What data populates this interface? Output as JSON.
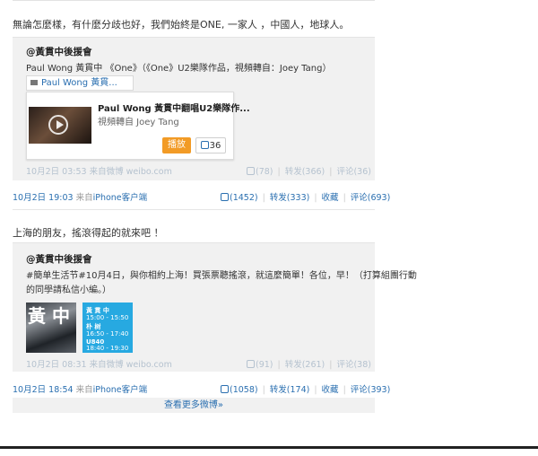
{
  "post1": {
    "text": "無論怎麼樣，有什麼分歧也好，我們始終是ONE, 一家人 ，中國人，地球人。",
    "repost": {
      "author": "@黃貫中後援會",
      "text": "Paul Wong 黃貫中 《One》（《One》U2樂隊作品，視頻轉自：Joey Tang）",
      "video_link": "Paul Wong 黃貫...",
      "card": {
        "title": "Paul Wong 黃貫中翻唱U2樂隊作...",
        "subtitle": "視頻轉自 Joey Tang",
        "play_label": "播放",
        "like_count": "36"
      },
      "meta": {
        "date": "10月2日 03:53",
        "source_prefix": "来自",
        "source": "微博 weibo.com"
      },
      "actions": {
        "like": "(78)",
        "forward": "转发(366)",
        "comment": "评论(36)"
      }
    },
    "meta": {
      "date": "10月2日 19:03",
      "source_prefix": "来自",
      "source": "iPhone客户端"
    },
    "actions": {
      "like": "(1452)",
      "forward": "转发(333)",
      "favorite": "收藏",
      "comment": "评论(693)"
    }
  },
  "post2": {
    "text": "上海的朋友，搖滾得起的就來吧 ！",
    "repost": {
      "author": "@黃貫中後援會",
      "text_line1": "#簡单生活节#10月4日，與你相約上海！買張票聽搖滾，就這麼簡單！各位，早！（打算組團行動",
      "text_line2": "的同學請私信小編。）",
      "photo_char": "黃 中",
      "poster": {
        "line1": "黃 貫 中",
        "line2": "15:00 - 15:50",
        "line3": "朴 树",
        "line4": "16:50 - 17:40",
        "line5": "U840",
        "line6": "18:40 - 19:30"
      },
      "meta": {
        "date": "10月2日 08:31",
        "source_prefix": "来自",
        "source": "微博 weibo.com"
      },
      "actions": {
        "like": "(91)",
        "forward": "转发(261)",
        "comment": "评论(38)"
      }
    },
    "meta": {
      "date": "10月2日 18:54",
      "source_prefix": "来自",
      "source": "iPhone客户端"
    },
    "actions": {
      "like": "(1058)",
      "forward": "转发(174)",
      "favorite": "收藏",
      "comment": "评论(393)"
    }
  },
  "more_label": "查看更多微博»"
}
